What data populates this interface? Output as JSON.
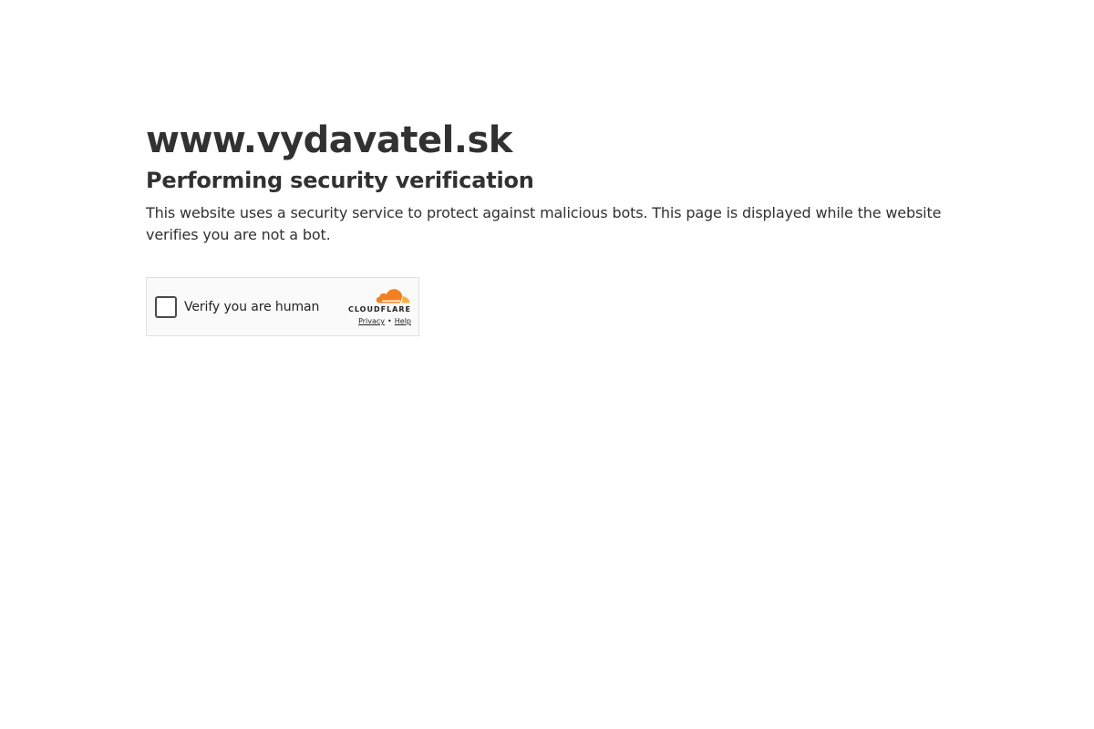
{
  "header": {
    "site_name": "www.vydavatel.sk",
    "subtitle": "Performing security verification",
    "description": "This website uses a security service to protect against malicious bots. This page is displayed while the website verifies you are not a bot."
  },
  "challenge_widget": {
    "checkbox_label": "Verify you are human",
    "checked": false,
    "brand": "CLOUDFLARE",
    "brand_icon": "cloudflare-cloud-icon",
    "privacy_link": "Privacy",
    "separator": "•",
    "help_link": "Help"
  },
  "colors": {
    "text": "#313131",
    "widget_border": "#e0e0e0",
    "widget_background": "#fafafa",
    "brand_orange": "#f38020",
    "brand_light_orange": "#faae40"
  }
}
